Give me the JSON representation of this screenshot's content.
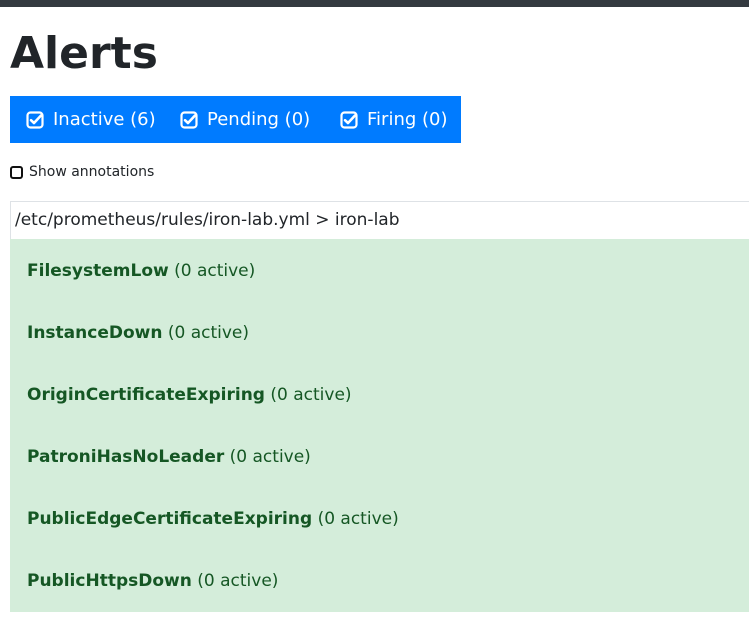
{
  "page": {
    "title": "Alerts"
  },
  "filters": [
    {
      "label": "Inactive (6)",
      "icon": "check-square-icon"
    },
    {
      "label": "Pending (0)",
      "icon": "check-square-icon"
    },
    {
      "label": "Firing (0)",
      "icon": "check-square-icon"
    }
  ],
  "annotations": {
    "label": "Show annotations",
    "checked": false
  },
  "group": {
    "header": "/etc/prometheus/rules/iron-lab.yml > iron-lab",
    "rules": [
      {
        "name": "FilesystemLow",
        "count": "(0 active)"
      },
      {
        "name": "InstanceDown",
        "count": "(0 active)"
      },
      {
        "name": "OriginCertificateExpiring",
        "count": "(0 active)"
      },
      {
        "name": "PatroniHasNoLeader",
        "count": "(0 active)"
      },
      {
        "name": "PublicEdgeCertificateExpiring",
        "count": "(0 active)"
      },
      {
        "name": "PublicHttpsDown",
        "count": "(0 active)"
      }
    ]
  },
  "colors": {
    "primary": "#007bff",
    "success_bg": "#d4edda",
    "success_text": "#155724",
    "navbar": "#343a40"
  }
}
